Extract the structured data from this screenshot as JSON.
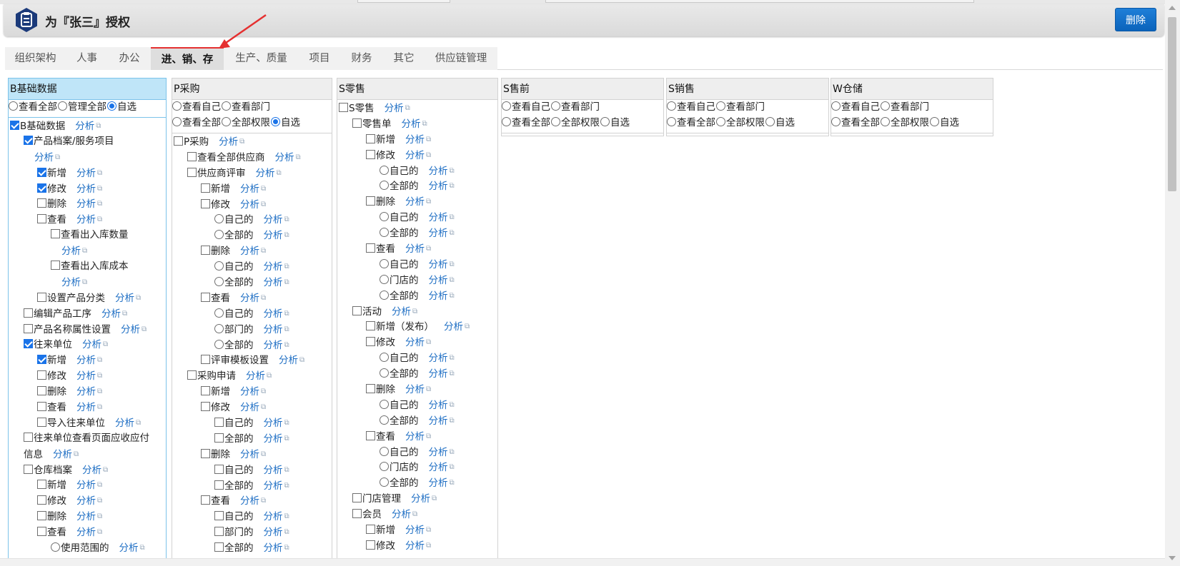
{
  "header": {
    "title": "为『张三』授权",
    "delete_label": "删除",
    "logo_icon": "clipboard-badge-icon",
    "colors": {
      "brand": "#1b3a7a",
      "button": "#1273d0"
    }
  },
  "tabs": [
    "组织架构",
    "人事",
    "办公",
    "进、销、存",
    "生产、质量",
    "项目",
    "财务",
    "其它",
    "供应链管理"
  ],
  "active_tab": "进、销、存",
  "analyze_label": "分析",
  "columns": [
    {
      "title": "B基础数据",
      "mode_rows": [
        [
          {
            "label": "查看全部",
            "checked": false
          },
          {
            "label": "管理全部",
            "checked": false
          },
          {
            "label": "自选",
            "checked": true
          }
        ]
      ],
      "items": [
        {
          "t": "cb",
          "label": "B基础数据",
          "checked": true,
          "indent": 0,
          "link": true
        },
        {
          "t": "cb",
          "label": "产品档案/服务项目",
          "checked": true,
          "indent": 1,
          "link": false
        },
        {
          "t": "txt",
          "label": "",
          "indent": 1,
          "link": true
        },
        {
          "t": "cb",
          "label": "新增",
          "checked": true,
          "indent": 2,
          "link": true
        },
        {
          "t": "cb",
          "label": "修改",
          "checked": true,
          "indent": 2,
          "link": true
        },
        {
          "t": "cb",
          "label": "删除",
          "checked": false,
          "indent": 2,
          "link": true
        },
        {
          "t": "cb",
          "label": "查看",
          "checked": false,
          "indent": 2,
          "link": true
        },
        {
          "t": "cb",
          "label": "查看出入库数量",
          "checked": false,
          "indent": 3,
          "link": false
        },
        {
          "t": "txt",
          "label": "",
          "indent": 3,
          "link": true
        },
        {
          "t": "cb",
          "label": "查看出入库成本",
          "checked": false,
          "indent": 3,
          "link": false
        },
        {
          "t": "txt",
          "label": "",
          "indent": 3,
          "link": true
        },
        {
          "t": "cb",
          "label": "设置产品分类",
          "checked": false,
          "indent": 2,
          "link": true
        },
        {
          "t": "cb",
          "label": "编辑产品工序",
          "checked": false,
          "indent": 1,
          "link": true
        },
        {
          "t": "cb",
          "label": "产品名称属性设置",
          "checked": false,
          "indent": 1,
          "link": true
        },
        {
          "t": "cb",
          "label": "往来单位",
          "checked": true,
          "indent": 1,
          "link": true
        },
        {
          "t": "cb",
          "label": "新增",
          "checked": true,
          "indent": 2,
          "link": true
        },
        {
          "t": "cb",
          "label": "修改",
          "checked": false,
          "indent": 2,
          "link": true
        },
        {
          "t": "cb",
          "label": "删除",
          "checked": false,
          "indent": 2,
          "link": true
        },
        {
          "t": "cb",
          "label": "查看",
          "checked": false,
          "indent": 2,
          "link": true
        },
        {
          "t": "cb",
          "label": "导入往来单位",
          "checked": false,
          "indent": 2,
          "link": true
        },
        {
          "t": "cb",
          "label": "往来单位查看页面应收应付",
          "checked": false,
          "indent": 1,
          "link": false
        },
        {
          "t": "txt",
          "label": "信息",
          "indent": 1,
          "link": true
        },
        {
          "t": "cb",
          "label": "仓库档案",
          "checked": false,
          "indent": 1,
          "link": true
        },
        {
          "t": "cb",
          "label": "新增",
          "checked": false,
          "indent": 2,
          "link": true
        },
        {
          "t": "cb",
          "label": "修改",
          "checked": false,
          "indent": 2,
          "link": true
        },
        {
          "t": "cb",
          "label": "删除",
          "checked": false,
          "indent": 2,
          "link": true
        },
        {
          "t": "cb",
          "label": "查看",
          "checked": false,
          "indent": 2,
          "link": true
        },
        {
          "t": "rd",
          "label": "使用范围的",
          "checked": false,
          "indent": 3,
          "link": true
        }
      ]
    },
    {
      "title": "P采购",
      "mode_rows": [
        [
          {
            "label": "查看自己",
            "checked": false
          },
          {
            "label": "查看部门",
            "checked": false
          }
        ],
        [
          {
            "label": "查看全部",
            "checked": false
          },
          {
            "label": "全部权限",
            "checked": false
          },
          {
            "label": "自选",
            "checked": true
          }
        ]
      ],
      "items": [
        {
          "t": "cb",
          "label": "P采购",
          "checked": false,
          "indent": 0,
          "link": true
        },
        {
          "t": "cb",
          "label": "查看全部供应商",
          "checked": false,
          "indent": 1,
          "link": true
        },
        {
          "t": "cb",
          "label": "供应商评审",
          "checked": false,
          "indent": 1,
          "link": true
        },
        {
          "t": "cb",
          "label": "新增",
          "checked": false,
          "indent": 2,
          "link": true
        },
        {
          "t": "cb",
          "label": "修改",
          "checked": false,
          "indent": 2,
          "link": true
        },
        {
          "t": "rd",
          "label": "自己的",
          "checked": false,
          "indent": 3,
          "link": true
        },
        {
          "t": "rd",
          "label": "全部的",
          "checked": false,
          "indent": 3,
          "link": true
        },
        {
          "t": "cb",
          "label": "删除",
          "checked": false,
          "indent": 2,
          "link": true
        },
        {
          "t": "rd",
          "label": "自己的",
          "checked": false,
          "indent": 3,
          "link": true
        },
        {
          "t": "rd",
          "label": "全部的",
          "checked": false,
          "indent": 3,
          "link": true
        },
        {
          "t": "cb",
          "label": "查看",
          "checked": false,
          "indent": 2,
          "link": true
        },
        {
          "t": "rd",
          "label": "自己的",
          "checked": false,
          "indent": 3,
          "link": true
        },
        {
          "t": "rd",
          "label": "部门的",
          "checked": false,
          "indent": 3,
          "link": true
        },
        {
          "t": "rd",
          "label": "全部的",
          "checked": false,
          "indent": 3,
          "link": true
        },
        {
          "t": "cb",
          "label": "评审模板设置",
          "checked": false,
          "indent": 2,
          "link": true
        },
        {
          "t": "cb",
          "label": "采购申请",
          "checked": false,
          "indent": 1,
          "link": true
        },
        {
          "t": "cb",
          "label": "新增",
          "checked": false,
          "indent": 2,
          "link": true
        },
        {
          "t": "cb",
          "label": "修改",
          "checked": false,
          "indent": 2,
          "link": true
        },
        {
          "t": "cb",
          "label": "自己的",
          "checked": false,
          "indent": 3,
          "link": true
        },
        {
          "t": "cb",
          "label": "全部的",
          "checked": false,
          "indent": 3,
          "link": true
        },
        {
          "t": "cb",
          "label": "删除",
          "checked": false,
          "indent": 2,
          "link": true
        },
        {
          "t": "cb",
          "label": "自己的",
          "checked": false,
          "indent": 3,
          "link": true
        },
        {
          "t": "cb",
          "label": "全部的",
          "checked": false,
          "indent": 3,
          "link": true
        },
        {
          "t": "cb",
          "label": "查看",
          "checked": false,
          "indent": 2,
          "link": true
        },
        {
          "t": "cb",
          "label": "自己的",
          "checked": false,
          "indent": 3,
          "link": true
        },
        {
          "t": "cb",
          "label": "部门的",
          "checked": false,
          "indent": 3,
          "link": true
        },
        {
          "t": "cb",
          "label": "全部的",
          "checked": false,
          "indent": 3,
          "link": true
        }
      ]
    },
    {
      "title": "S零售",
      "mode_rows": [],
      "items": [
        {
          "t": "cb",
          "label": "S零售",
          "checked": false,
          "indent": 0,
          "link": true
        },
        {
          "t": "cb",
          "label": "零售单",
          "checked": false,
          "indent": 1,
          "link": true
        },
        {
          "t": "cb",
          "label": "新增",
          "checked": false,
          "indent": 2,
          "link": true
        },
        {
          "t": "cb",
          "label": "修改",
          "checked": false,
          "indent": 2,
          "link": true
        },
        {
          "t": "rd",
          "label": "自己的",
          "checked": false,
          "indent": 3,
          "link": true
        },
        {
          "t": "rd",
          "label": "全部的",
          "checked": false,
          "indent": 3,
          "link": true
        },
        {
          "t": "cb",
          "label": "删除",
          "checked": false,
          "indent": 2,
          "link": true
        },
        {
          "t": "rd",
          "label": "自己的",
          "checked": false,
          "indent": 3,
          "link": true
        },
        {
          "t": "rd",
          "label": "全部的",
          "checked": false,
          "indent": 3,
          "link": true
        },
        {
          "t": "cb",
          "label": "查看",
          "checked": false,
          "indent": 2,
          "link": true
        },
        {
          "t": "rd",
          "label": "自己的",
          "checked": false,
          "indent": 3,
          "link": true
        },
        {
          "t": "rd",
          "label": "门店的",
          "checked": false,
          "indent": 3,
          "link": true
        },
        {
          "t": "rd",
          "label": "全部的",
          "checked": false,
          "indent": 3,
          "link": true
        },
        {
          "t": "cb",
          "label": "活动",
          "checked": false,
          "indent": 1,
          "link": true
        },
        {
          "t": "cb",
          "label": "新增（发布）",
          "checked": false,
          "indent": 2,
          "link": true
        },
        {
          "t": "cb",
          "label": "修改",
          "checked": false,
          "indent": 2,
          "link": true
        },
        {
          "t": "rd",
          "label": "自己的",
          "checked": false,
          "indent": 3,
          "link": true
        },
        {
          "t": "rd",
          "label": "全部的",
          "checked": false,
          "indent": 3,
          "link": true
        },
        {
          "t": "cb",
          "label": "删除",
          "checked": false,
          "indent": 2,
          "link": true
        },
        {
          "t": "rd",
          "label": "自己的",
          "checked": false,
          "indent": 3,
          "link": true
        },
        {
          "t": "rd",
          "label": "全部的",
          "checked": false,
          "indent": 3,
          "link": true
        },
        {
          "t": "cb",
          "label": "查看",
          "checked": false,
          "indent": 2,
          "link": true
        },
        {
          "t": "rd",
          "label": "自己的",
          "checked": false,
          "indent": 3,
          "link": true
        },
        {
          "t": "rd",
          "label": "门店的",
          "checked": false,
          "indent": 3,
          "link": true
        },
        {
          "t": "rd",
          "label": "全部的",
          "checked": false,
          "indent": 3,
          "link": true
        },
        {
          "t": "cb",
          "label": "门店管理",
          "checked": false,
          "indent": 1,
          "link": true
        },
        {
          "t": "cb",
          "label": "会员",
          "checked": false,
          "indent": 1,
          "link": true
        },
        {
          "t": "cb",
          "label": "新增",
          "checked": false,
          "indent": 2,
          "link": true
        },
        {
          "t": "cb",
          "label": "修改",
          "checked": false,
          "indent": 2,
          "link": true
        }
      ]
    },
    {
      "title": "S售前",
      "mode_rows": [
        [
          {
            "label": "查看自己",
            "checked": false
          },
          {
            "label": "查看部门",
            "checked": false
          }
        ],
        [
          {
            "label": "查看全部",
            "checked": false
          },
          {
            "label": "全部权限",
            "checked": false
          },
          {
            "label": "自选",
            "checked": false
          }
        ]
      ],
      "items": []
    },
    {
      "title": "S销售",
      "mode_rows": [
        [
          {
            "label": "查看自己",
            "checked": false
          },
          {
            "label": "查看部门",
            "checked": false
          }
        ],
        [
          {
            "label": "查看全部",
            "checked": false
          },
          {
            "label": "全部权限",
            "checked": false
          },
          {
            "label": "自选",
            "checked": false
          }
        ]
      ],
      "items": []
    },
    {
      "title": "W仓储",
      "mode_rows": [
        [
          {
            "label": "查看自己",
            "checked": false
          },
          {
            "label": "查看部门",
            "checked": false
          }
        ],
        [
          {
            "label": "查看全部",
            "checked": false
          },
          {
            "label": "全部权限",
            "checked": false
          },
          {
            "label": "自选",
            "checked": false
          }
        ]
      ],
      "items": []
    }
  ]
}
